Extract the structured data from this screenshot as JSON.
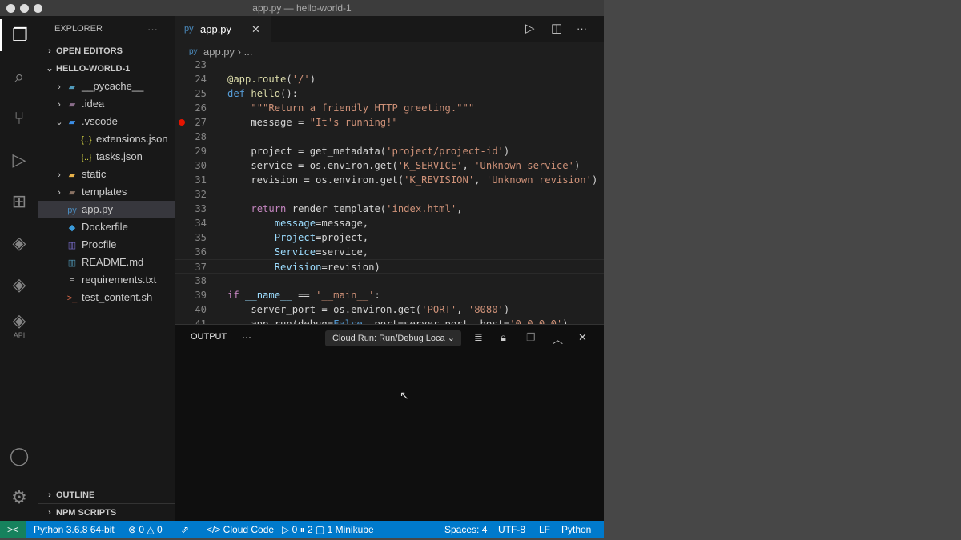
{
  "window": {
    "title": "app.py — hello-world-1"
  },
  "activity_bar": [
    "explorer-icon",
    "search-icon",
    "source-control-icon",
    "run-debug-icon",
    "extensions-icon",
    "cloud-code-icon",
    "cloud-run-icon",
    "api-icon",
    "account-icon",
    "gear-icon"
  ],
  "activity_api_label": "API",
  "sidebar": {
    "title": "EXPLORER",
    "more": "···",
    "open_editors": "OPEN EDITORS",
    "project": "HELLO-WORLD-1",
    "items": [
      {
        "label": "__pycache__",
        "indent": 1,
        "chev": "›",
        "icon": "▰",
        "color": "#519aba"
      },
      {
        "label": ".idea",
        "indent": 1,
        "chev": "›",
        "icon": "▰",
        "color": "#8a6d8a"
      },
      {
        "label": ".vscode",
        "indent": 1,
        "chev": "⌄",
        "icon": "▰",
        "color": "#3c8ee6"
      },
      {
        "label": "extensions.json",
        "indent": 2,
        "chev": "",
        "icon": "{..}",
        "color": "#cbcb41"
      },
      {
        "label": "tasks.json",
        "indent": 2,
        "chev": "",
        "icon": "{..}",
        "color": "#cbcb41"
      },
      {
        "label": "static",
        "indent": 1,
        "chev": "›",
        "icon": "▰",
        "color": "#e8b24a"
      },
      {
        "label": "templates",
        "indent": 1,
        "chev": "›",
        "icon": "▰",
        "color": "#8b7364"
      },
      {
        "label": "app.py",
        "indent": 1,
        "chev": "",
        "icon": "py",
        "color": "#4b8bbe",
        "selected": true
      },
      {
        "label": "Dockerfile",
        "indent": 1,
        "chev": "",
        "icon": "◆",
        "color": "#3a9ad9"
      },
      {
        "label": "Procfile",
        "indent": 1,
        "chev": "",
        "icon": "▥",
        "color": "#7b6fcf"
      },
      {
        "label": "README.md",
        "indent": 1,
        "chev": "",
        "icon": "▥",
        "color": "#519aba"
      },
      {
        "label": "requirements.txt",
        "indent": 1,
        "chev": "",
        "icon": "≡",
        "color": "#aaa"
      },
      {
        "label": "test_content.sh",
        "indent": 1,
        "chev": "",
        "icon": ">_",
        "color": "#e06c4b"
      }
    ],
    "outline": "OUTLINE",
    "npm": "NPM SCRIPTS"
  },
  "editor": {
    "tab": "app.py",
    "breadcrumb": "app.py",
    "breadcrumb_more": "...",
    "lines": [
      {
        "n": "23",
        "html": ""
      },
      {
        "n": "24",
        "html": "<span class='f'>@app.route</span>(<span class='s'>'/'</span>)"
      },
      {
        "n": "25",
        "html": "<span class='k'>def</span> <span class='f'>hello</span>():"
      },
      {
        "n": "26",
        "html": "    <span class='s'>\"\"\"Return a friendly HTTP greeting.\"\"\"</span>"
      },
      {
        "n": "27",
        "html": "    message = <span class='s'>\"It's running!\"</span>",
        "bp": true
      },
      {
        "n": "28",
        "html": ""
      },
      {
        "n": "29",
        "html": "    project = get_metadata(<span class='s'>'project/project-id'</span>)"
      },
      {
        "n": "30",
        "html": "    service = os.environ.get(<span class='s'>'K_SERVICE'</span>, <span class='s'>'Unknown service'</span>)"
      },
      {
        "n": "31",
        "html": "    revision = os.environ.get(<span class='s'>'K_REVISION'</span>, <span class='s'>'Unknown revision'</span>)"
      },
      {
        "n": "32",
        "html": ""
      },
      {
        "n": "33",
        "html": "    <span class='kc'>return</span> render_template(<span class='s'>'index.html'</span>,"
      },
      {
        "n": "34",
        "html": "        <span class='p'>message</span>=message,"
      },
      {
        "n": "35",
        "html": "        <span class='p'>Project</span>=project,"
      },
      {
        "n": "36",
        "html": "        <span class='p'>Service</span>=service,"
      },
      {
        "n": "37",
        "html": "        <span class='p'>Revision</span>=revision)"
      },
      {
        "n": "38",
        "html": ""
      },
      {
        "n": "39",
        "html": "<span class='kc'>if</span> <span class='p'>__name__</span> == <span class='s'>'__main__'</span>:"
      },
      {
        "n": "40",
        "html": "    server_port = os.environ.get(<span class='s'>'PORT'</span>, <span class='s'>'8080'</span>)"
      },
      {
        "n": "41",
        "html": "    app.run(debug=<span class='k'>False</span>, port=server_port, host=<span class='s'>'0.0.0.0'</span>)"
      }
    ]
  },
  "panel": {
    "tab": "OUTPUT",
    "more": "···",
    "channel": "Cloud Run: Run/Debug Loca"
  },
  "status": {
    "remote": "><",
    "python": "Python 3.6.8 64-bit",
    "problems": "⊗ 0 △ 0",
    "cloud_code": "</> Cloud Code",
    "runs": "▷ 0 ⏸ 2 ▢ 1 Minikube",
    "spaces": "Spaces: 4",
    "encoding": "UTF-8",
    "eol": "LF",
    "language": "Python"
  }
}
